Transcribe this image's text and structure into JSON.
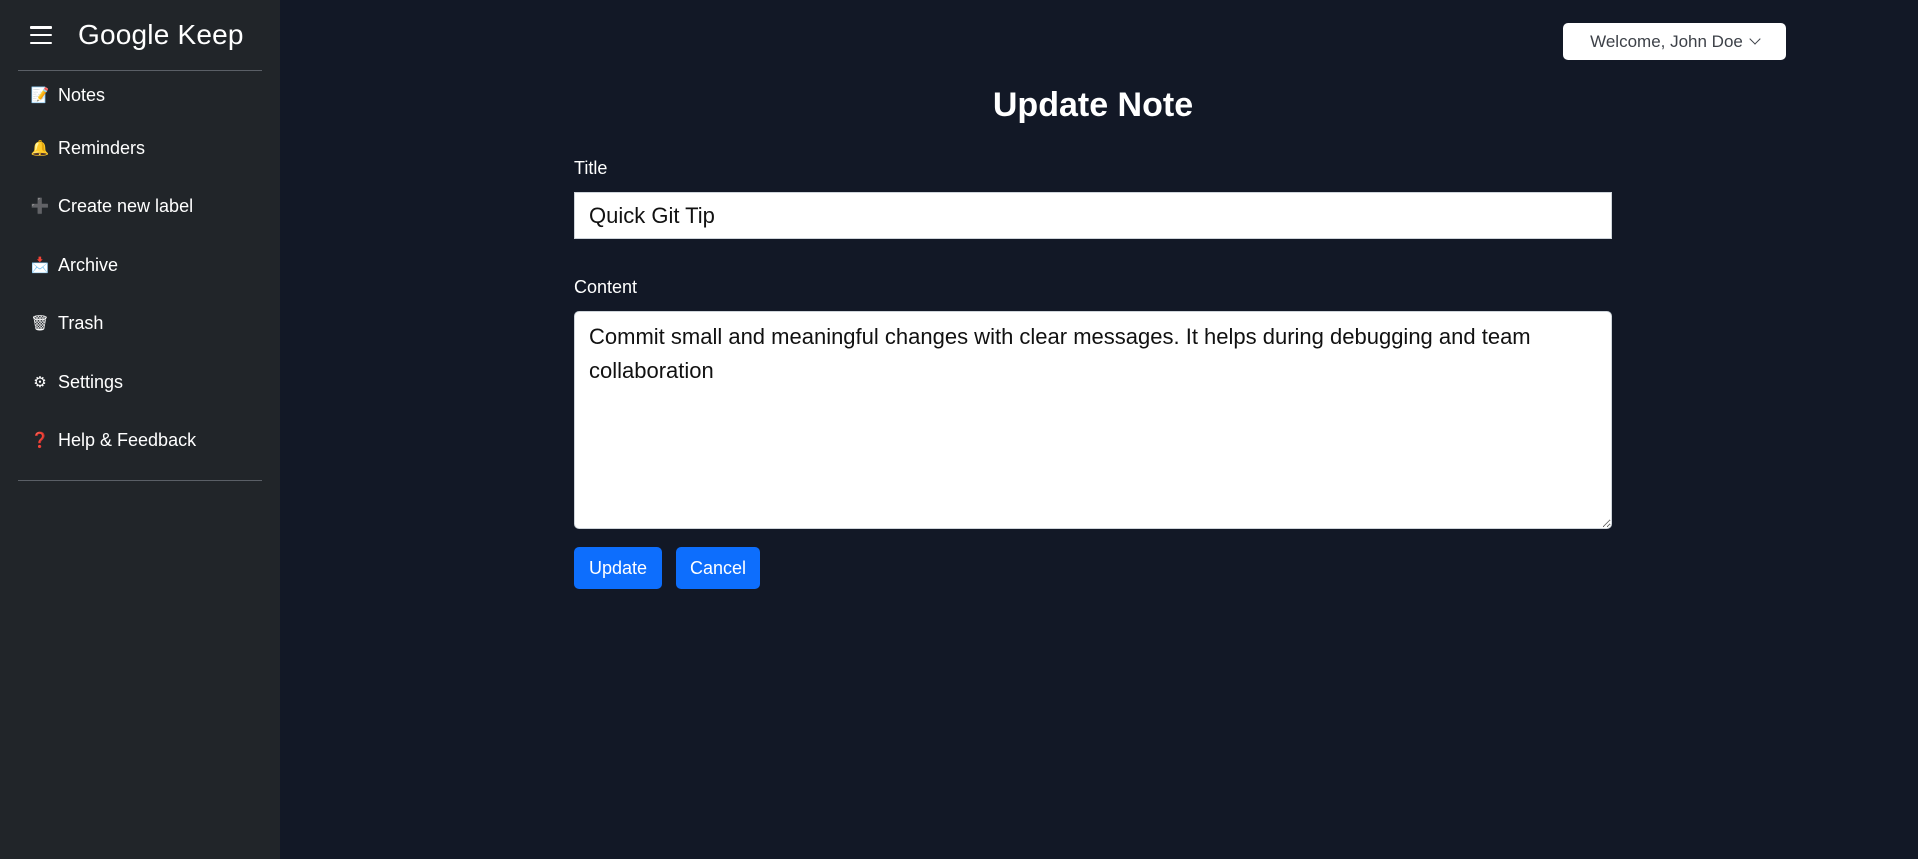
{
  "app": {
    "title": "Google Keep"
  },
  "sidebar": {
    "items": [
      {
        "label": "Notes",
        "icon": "note-icon",
        "glyph": "📝"
      },
      {
        "label": "Reminders",
        "icon": "bell-icon",
        "glyph": "🔔"
      },
      {
        "label": "Create new label",
        "icon": "plus-icon",
        "glyph": "➕"
      },
      {
        "label": "Archive",
        "icon": "archive-icon",
        "glyph": "📩"
      },
      {
        "label": "Trash",
        "icon": "trash-icon",
        "glyph": "🗑"
      },
      {
        "label": "Settings",
        "icon": "gear-icon",
        "glyph": "⚙"
      },
      {
        "label": "Help & Feedback",
        "icon": "question-icon",
        "glyph": "❓"
      }
    ]
  },
  "header": {
    "user_menu_label": "Welcome, John Doe"
  },
  "form": {
    "heading": "Update Note",
    "title_label": "Title",
    "title_value": "Quick Git Tip",
    "content_label": "Content",
    "content_value": "Commit small and meaningful changes with clear messages. It helps during debugging and team collaboration",
    "update_label": "Update",
    "cancel_label": "Cancel"
  },
  "colors": {
    "page_background": "#121826",
    "sidebar_background": "#212529",
    "primary_button": "#0d6efd"
  }
}
